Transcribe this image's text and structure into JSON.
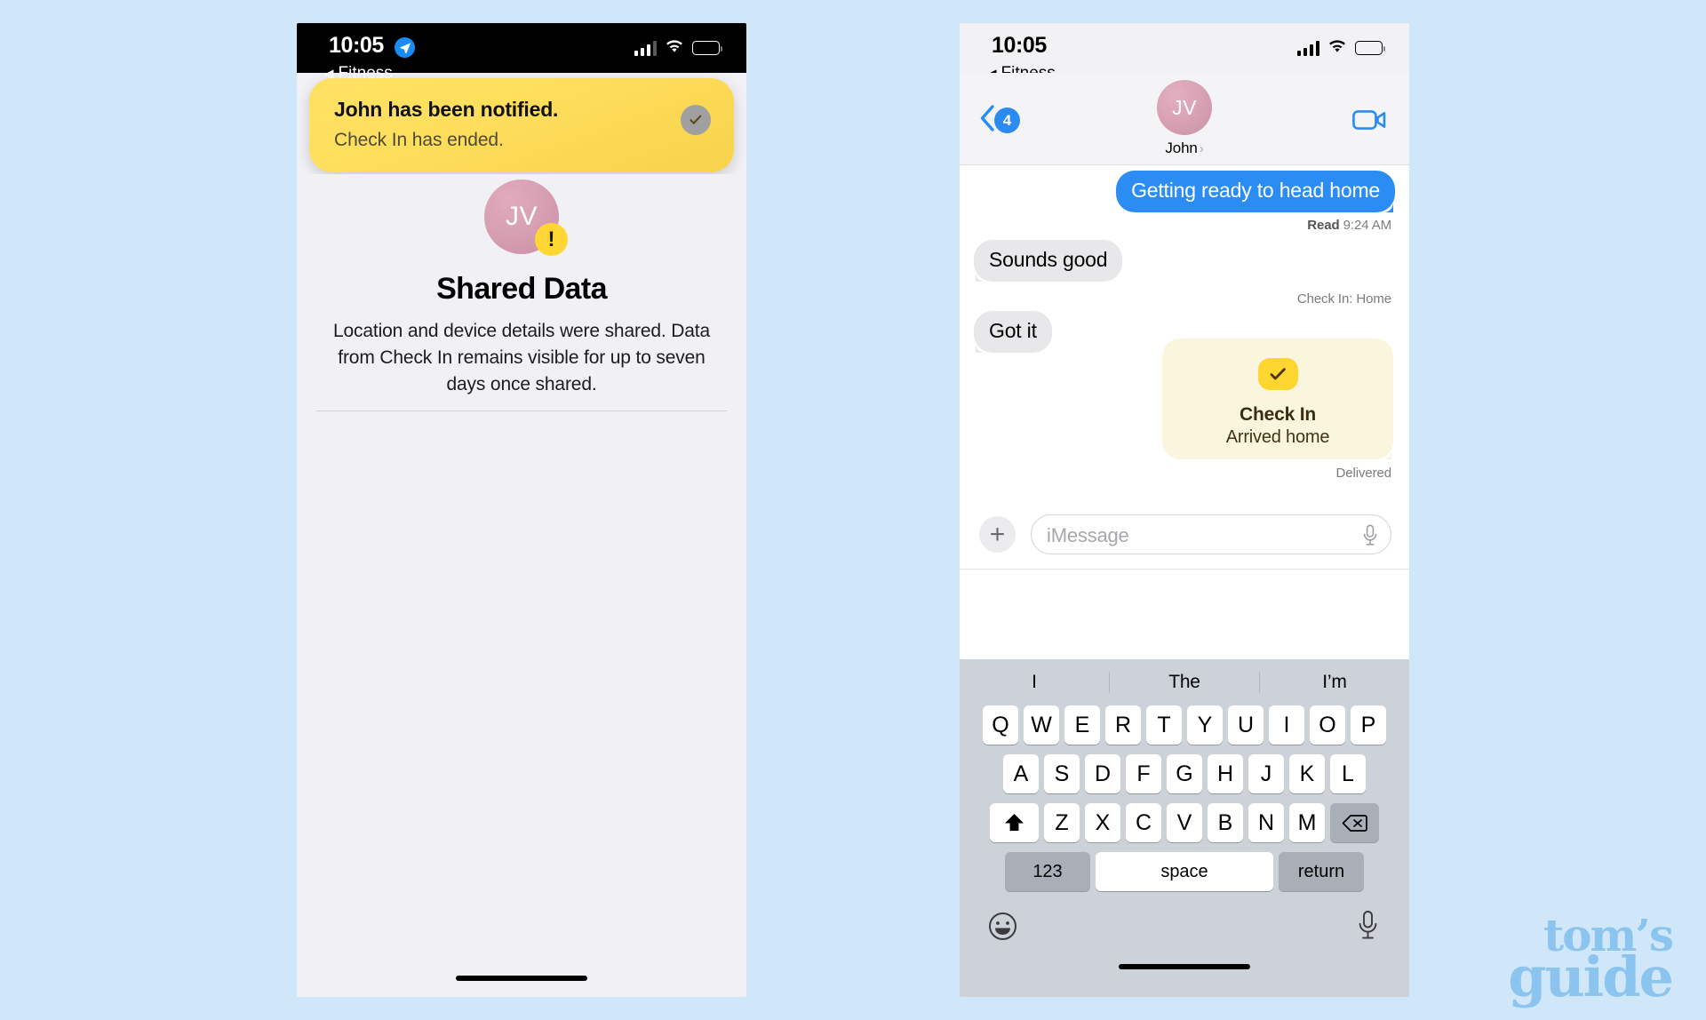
{
  "background_color": "#cfe7f9",
  "left_phone": {
    "status_bar": {
      "time": "10:05",
      "location_icon": "location-arrow-icon",
      "signal_icon": "cellular-bars-icon",
      "wifi_icon": "wifi-icon",
      "battery_icon": "battery-icon"
    },
    "back_label": "Fitness",
    "notification": {
      "title": "John has been notified.",
      "subtitle": "Check In has ended.",
      "badge_icon": "checkmark-icon",
      "badge_color": "#a0a0a0",
      "background_color": "#ffdf5e"
    },
    "shared_data": {
      "avatar_initials": "JV",
      "avatar_color": "#d8a0b3",
      "alert_badge": "!",
      "alert_badge_color": "#ffd633",
      "title": "Shared Data",
      "description": "Location and device details were shared. Data from Check In remains visible for up to seven days once shared."
    }
  },
  "right_phone": {
    "status_bar": {
      "time": "10:05",
      "signal_icon": "cellular-bars-icon",
      "wifi_icon": "wifi-icon",
      "battery_icon": "battery-icon"
    },
    "back_label": "Fitness",
    "header": {
      "back_badge_count": "4",
      "back_badge_color": "#2a8bf2",
      "avatar_initials": "JV",
      "avatar_color": "#d9a3b4",
      "contact_name": "John",
      "contact_chevron": "›",
      "facetime_icon": "video-camera-icon",
      "facetime_color": "#2a8bf2"
    },
    "messages": [
      {
        "id": "m1",
        "direction": "outgoing",
        "text": "Getting ready to head home",
        "bubble_color": "#2b8cf4"
      },
      {
        "id": "m1_status",
        "type": "status",
        "label": "Read",
        "time": "9:24 AM"
      },
      {
        "id": "m2",
        "direction": "incoming",
        "text": "Sounds good",
        "bubble_color": "#e8e8ea"
      },
      {
        "id": "m3",
        "type": "label",
        "text": "Check In: Home"
      },
      {
        "id": "m4",
        "direction": "incoming",
        "text": "Got it",
        "bubble_color": "#e8e8ea"
      }
    ],
    "checkin_card": {
      "icon": "checkmark-icon",
      "icon_bg_color": "#ffd530",
      "card_color": "#faf6de",
      "title": "Check In",
      "subtitle": "Arrived home",
      "status": "Delivered"
    },
    "input_bar": {
      "plus_icon": "plus-icon",
      "placeholder": "iMessage",
      "mic_icon": "microphone-icon"
    },
    "keyboard": {
      "predictions": [
        "I",
        "The",
        "I’m"
      ],
      "row1": [
        "Q",
        "W",
        "E",
        "R",
        "T",
        "Y",
        "U",
        "I",
        "O",
        "P"
      ],
      "row2": [
        "A",
        "S",
        "D",
        "F",
        "G",
        "H",
        "J",
        "K",
        "L"
      ],
      "row3": [
        "Z",
        "X",
        "C",
        "V",
        "B",
        "N",
        "M"
      ],
      "shift_icon": "shift-arrow-icon",
      "delete_icon": "backspace-icon",
      "numbers_key": "123",
      "space_key": "space",
      "return_key": "return",
      "emoji_icon": "emoji-smiley-icon",
      "dictation_icon": "microphone-icon"
    }
  },
  "watermark": {
    "line1": "tom’s",
    "line2": "guide",
    "color": "#8cc4f0"
  }
}
